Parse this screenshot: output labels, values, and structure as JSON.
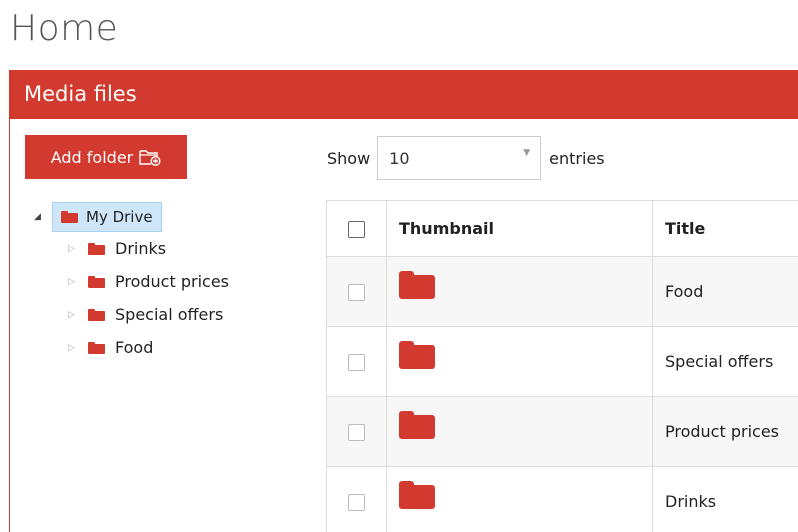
{
  "page": {
    "title": "Home"
  },
  "panel": {
    "title": "Media files"
  },
  "toolbar": {
    "add_folder_label": "Add folder"
  },
  "tree": {
    "root": {
      "label": "My Drive",
      "expanded": true,
      "icon": "folder-icon"
    },
    "children": [
      {
        "label": "Drinks",
        "icon": "folder-icon"
      },
      {
        "label": "Product prices",
        "icon": "folder-icon"
      },
      {
        "label": "Special offers",
        "icon": "folder-icon"
      },
      {
        "label": "Food",
        "icon": "folder-icon"
      }
    ]
  },
  "entries": {
    "show_label": "Show",
    "value": "10",
    "suffix": "entries"
  },
  "table": {
    "columns": [
      "Thumbnail",
      "Title"
    ],
    "rows": [
      {
        "thumbnail": "folder-icon",
        "title": "Food"
      },
      {
        "thumbnail": "folder-icon",
        "title": "Special offers"
      },
      {
        "thumbnail": "folder-icon",
        "title": "Product prices"
      },
      {
        "thumbnail": "folder-icon",
        "title": "Drinks"
      }
    ]
  },
  "colors": {
    "accent": "#d33a2f",
    "selection": "#cfe6f8"
  }
}
